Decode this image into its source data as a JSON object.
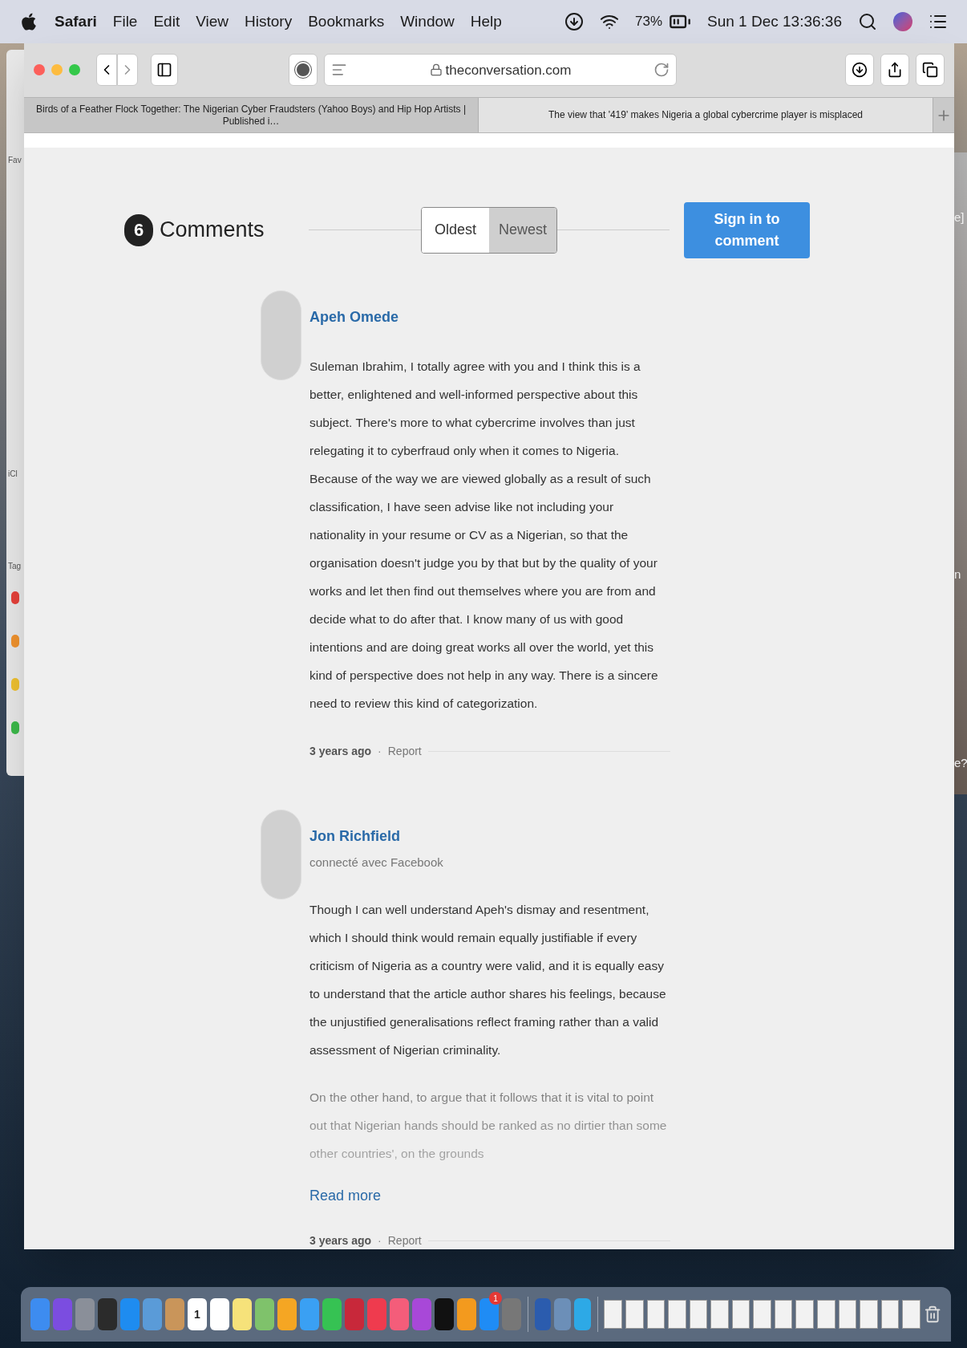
{
  "menu_bar": {
    "app": "Safari",
    "menus": [
      "File",
      "Edit",
      "View",
      "History",
      "Bookmarks",
      "Window",
      "Help"
    ],
    "battery": "73%",
    "clock": "Sun 1 Dec 13:36:36"
  },
  "background_window": {
    "sections": [
      "Fav",
      "iCl",
      "Tag"
    ],
    "tags": [
      {
        "color": "#e5413a"
      },
      {
        "color": "#f0922e"
      },
      {
        "color": "#efc130"
      },
      {
        "color": "#3cb94a"
      }
    ]
  },
  "right_window": {
    "fragments": [
      "e]",
      "n",
      "e?"
    ]
  },
  "browser": {
    "address": "theconversation.com",
    "tabs": [
      {
        "title": "Birds of a Feather Flock Together: The Nigerian Cyber Fraudsters (Yahoo Boys) and Hip Hop Artists | Published i…",
        "selected": false
      },
      {
        "title": "The view that '419' makes Nigeria a global cybercrime player is misplaced",
        "selected": true
      }
    ]
  },
  "comments": {
    "count": "6",
    "title": "Comments",
    "sort": [
      {
        "label": "Oldest",
        "selected": true
      },
      {
        "label": "Newest",
        "selected": false
      }
    ],
    "sign_in": "Sign in to comment",
    "items": [
      {
        "author": "Apeh Omede",
        "paragraphs": [
          {
            "text": "Suleman Ibrahim, I totally agree with you and I think this is a better, enlightened and well-informed perspective about this subject. There's more to what cybercrime involves than just relegating it to cyberfraud only when it comes to Nigeria. Because of the way we are viewed globally as a result of such classification, I have seen advise like not including your nationality in your resume or CV as a Nigerian, so that the organisation doesn't judge you by that but by the quality of your works and let then find out themselves where you are from and decide what to do after that. I know many of us with good intentions and are doing great works all over the world, yet this kind of perspective does not help in any way. There is a sincere need to review this kind of categorization.",
            "faded": false
          }
        ],
        "time": "3 years ago",
        "separator": "·",
        "report": "Report"
      },
      {
        "author": "Jon Richfield",
        "subtitle": "connecté avec Facebook",
        "paragraphs": [
          {
            "text": "Though I can well understand Apeh's dismay and resentment, which I should think would remain equally justifiable if every criticism of Nigeria as a country were valid, and it is equally easy to understand that the article author shares his feelings, because the unjustified generalisations reflect framing rather than a valid assessment of Nigerian criminality.",
            "faded": false
          },
          {
            "text": "On the other hand, to argue that it follows that it is vital to point out that Nigerian hands should be ranked as no dirtier than some other countries', on the grounds",
            "faded": true
          }
        ],
        "read_more": "Read more",
        "time": "3 years ago",
        "separator": "·",
        "report": "Report"
      }
    ]
  },
  "dock": {
    "calendar_day": "1",
    "app_badge": "1"
  }
}
